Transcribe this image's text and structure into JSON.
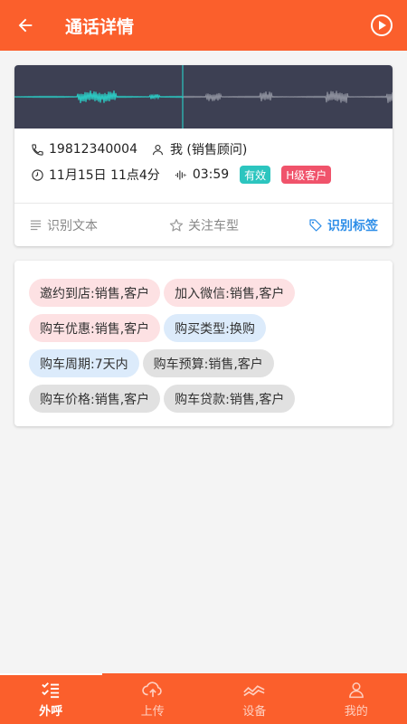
{
  "header": {
    "title": "通话详情",
    "back_icon": "arrow-left-icon",
    "play_icon": "play-circle-icon"
  },
  "call": {
    "phone": "19812340004",
    "owner": "我 (销售顾问)",
    "time": "11月15日 11点4分",
    "duration": "03:59",
    "valid_badge": "有效",
    "level_badge": "H级客户",
    "played_fraction": 0.445
  },
  "actions": {
    "text_label": "识别文本",
    "car_label": "关注车型",
    "tag_label": "识别标签"
  },
  "tags": [
    {
      "label": "邀约到店:销售,客户",
      "color": "pink"
    },
    {
      "label": "加入微信:销售,客户",
      "color": "pink"
    },
    {
      "label": "购车优惠:销售,客户",
      "color": "pink"
    },
    {
      "label": "购买类型:换购",
      "color": "blue"
    },
    {
      "label": "购车周期:7天内",
      "color": "blue"
    },
    {
      "label": "购车预算:销售,客户",
      "color": "gray"
    },
    {
      "label": "购车价格:销售,客户",
      "color": "gray"
    },
    {
      "label": "购车贷款:销售,客户",
      "color": "gray"
    }
  ],
  "tabbar": [
    {
      "label": "外呼",
      "icon": "checklist-icon",
      "active": true
    },
    {
      "label": "上传",
      "icon": "cloud-upload-icon",
      "active": false
    },
    {
      "label": "设备",
      "icon": "wave-icon",
      "active": false
    },
    {
      "label": "我的",
      "icon": "user-icon",
      "active": false
    }
  ],
  "colors": {
    "primary": "#fb5f2c",
    "accent_teal": "#2cc5bf",
    "tag_blue": "#2e8ee8",
    "badge_red": "#f0536b"
  }
}
